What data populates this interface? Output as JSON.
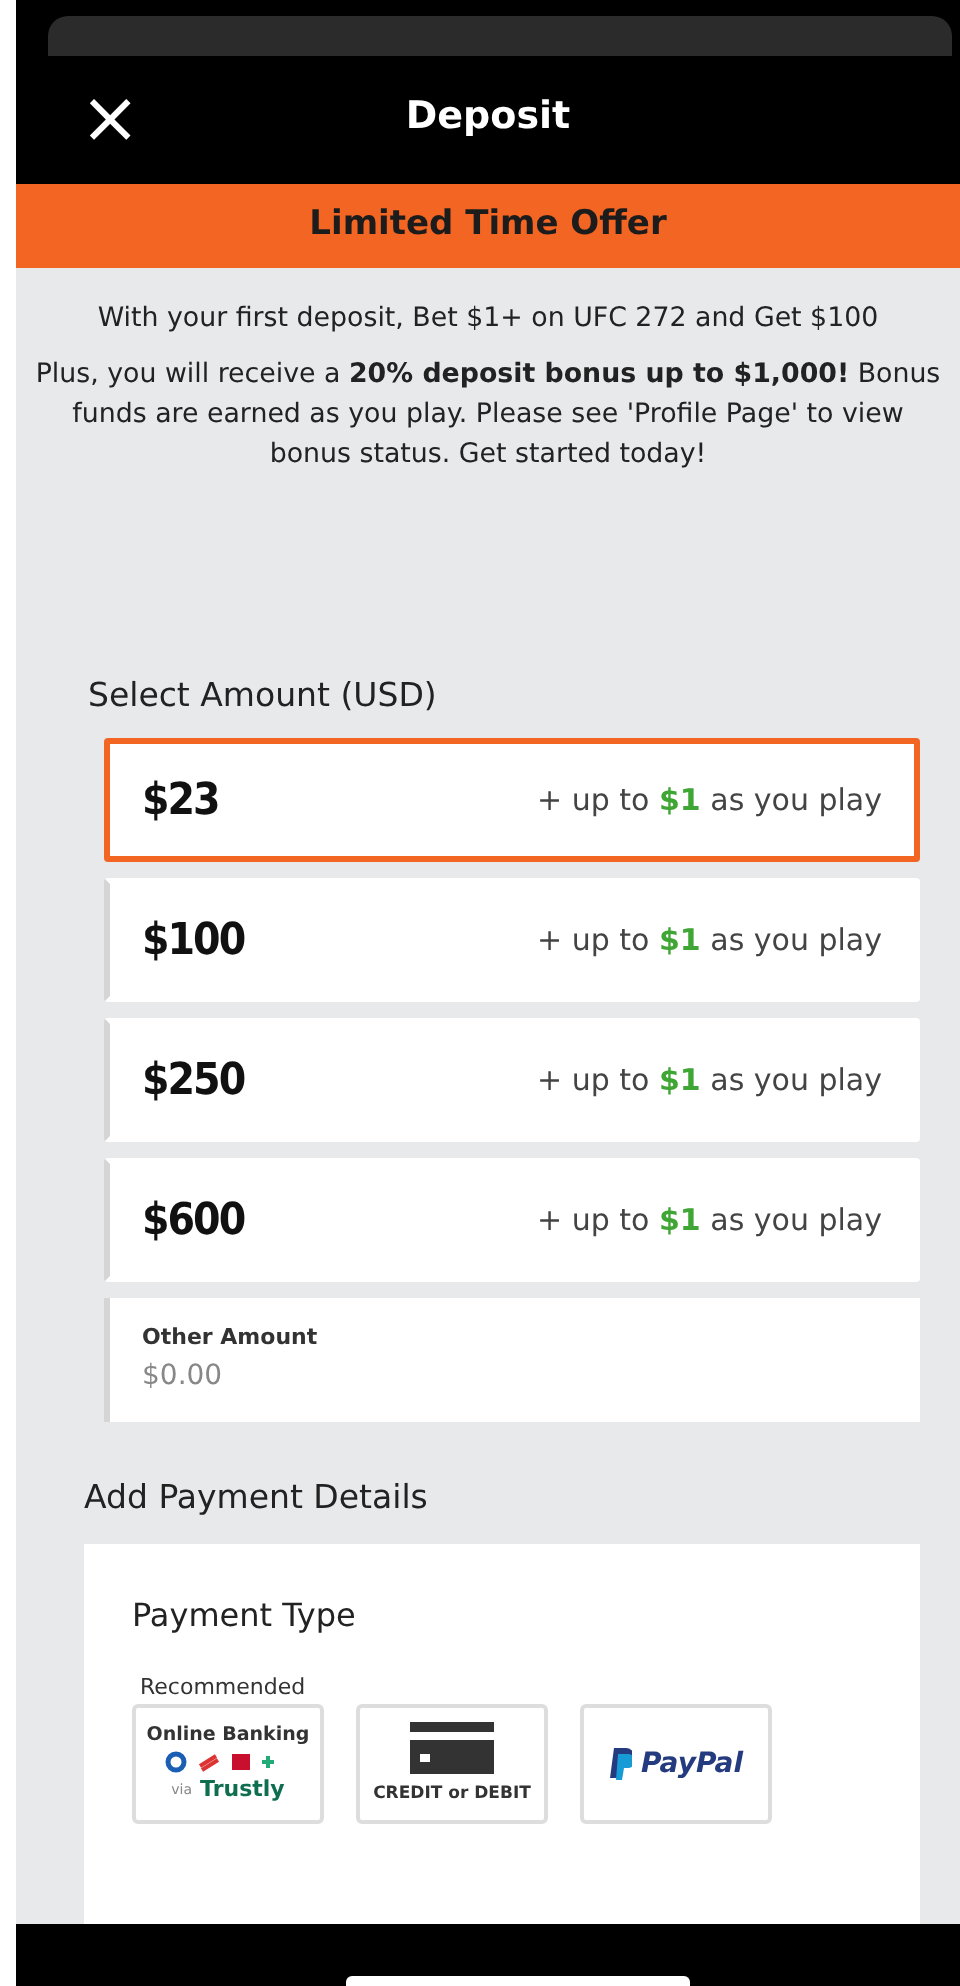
{
  "header": {
    "close": "×",
    "title": "Deposit"
  },
  "banner": "Limited Time Offer",
  "promo": [
    "With your first deposit, Bet $1+ on UFC 272 and Get $100",
    "Plus, you will receive a **20% deposit bonus up to $1,000!** Bonus funds are earned as you play. Please see 'Profile Page' to view bonus status. Get started today!"
  ],
  "amount_heading": "Select Amount (USD)",
  "amounts": [
    {
      "amount": "$23",
      "prefix": "+ up to",
      "bonus": "$1",
      "suffix": "as you play",
      "selected": true
    },
    {
      "amount": "$100",
      "prefix": "+ up to",
      "bonus": "$1",
      "suffix": "as you play",
      "selected": false
    },
    {
      "amount": "$250",
      "prefix": "+ up to",
      "bonus": "$1",
      "suffix": "as you play",
      "selected": false
    },
    {
      "amount": "$600",
      "prefix": "+ up to",
      "bonus": "$1",
      "suffix": "as you play",
      "selected": false
    }
  ],
  "other_amount": {
    "label": "Other Amount",
    "placeholder": "$0.00"
  },
  "payment_heading": "Add Payment Details",
  "payment_type": {
    "title": "Payment Type",
    "options": [
      {
        "kind": "bank",
        "tag": "Recommended",
        "label": "Online Banking",
        "via": "via",
        "provider": "Trustly"
      },
      {
        "kind": "card",
        "label": "CREDIT or DEBIT"
      },
      {
        "kind": "paypal",
        "label": "PayPal"
      }
    ]
  }
}
